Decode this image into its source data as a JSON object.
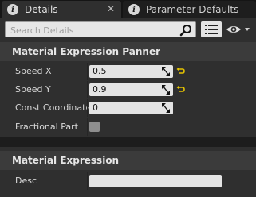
{
  "tabs": [
    {
      "label": "Details",
      "icon": "info-icon",
      "close": "✕"
    },
    {
      "label": "Parameter Defaults",
      "icon": "info-icon"
    }
  ],
  "search": {
    "placeholder": "Search Details"
  },
  "categories": [
    {
      "title": "Material Expression Panner",
      "properties": [
        {
          "label": "Speed X",
          "value": "0.5"
        },
        {
          "label": "Speed Y",
          "value": "0.9"
        },
        {
          "label": "Const Coordinate",
          "value": "0"
        },
        {
          "label": "Fractional Part",
          "checked": false
        }
      ]
    },
    {
      "title": "Material Expression",
      "properties": [
        {
          "label": "Desc",
          "value": ""
        }
      ]
    }
  ],
  "colors": {
    "reset_arrow": "#e5c300",
    "panel_bg": "#2f2f2f",
    "category_bg": "#3b3b3b"
  }
}
